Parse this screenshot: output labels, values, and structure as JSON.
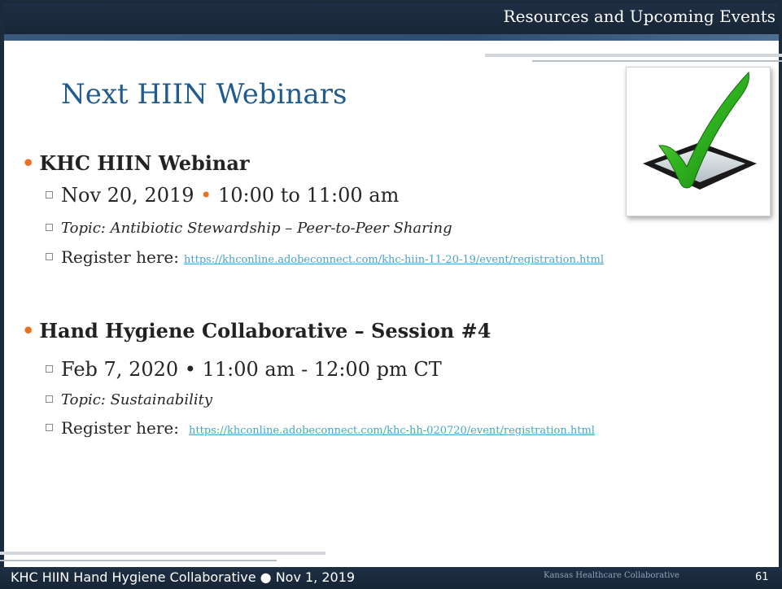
{
  "header": {
    "section_title": "Resources and Upcoming Events"
  },
  "slide": {
    "title": "Next HIIN Webinars"
  },
  "events": [
    {
      "name": "KHC HIIN Webinar",
      "date": "Nov 20, 2019",
      "separator": "•",
      "time": "10:00 to 11:00 am",
      "topic": "Topic: Antibiotic Stewardship – Peer-to-Peer Sharing",
      "register_label": "Register here:",
      "register_url": "https://khconline.adobeconnect.com/khc-hiin-11-20-19/event/registration.html"
    },
    {
      "name": "Hand Hygiene Collaborative – Session #4",
      "date": "Feb 7, 2020",
      "separator": "•",
      "time": "11:00 am - 12:00 pm CT",
      "topic": "Topic: Sustainability",
      "register_label": "Register here:",
      "register_url": "https://khconline.adobeconnect.com/khc-hh-020720/event/registration.html"
    }
  ],
  "footer": {
    "left_text": "KHC HIIN Hand Hygiene Collaborative ● Nov 1, 2019",
    "organization": "Kansas Healthcare Collaborative",
    "page_number": "61"
  },
  "icons": {
    "checkmark": "checkmark-icon"
  },
  "colors": {
    "header_bg": "#1f2f44",
    "title_blue": "#1f5b8f",
    "accent_orange": "#e8731e",
    "link_blue": "#4aa3c8"
  }
}
